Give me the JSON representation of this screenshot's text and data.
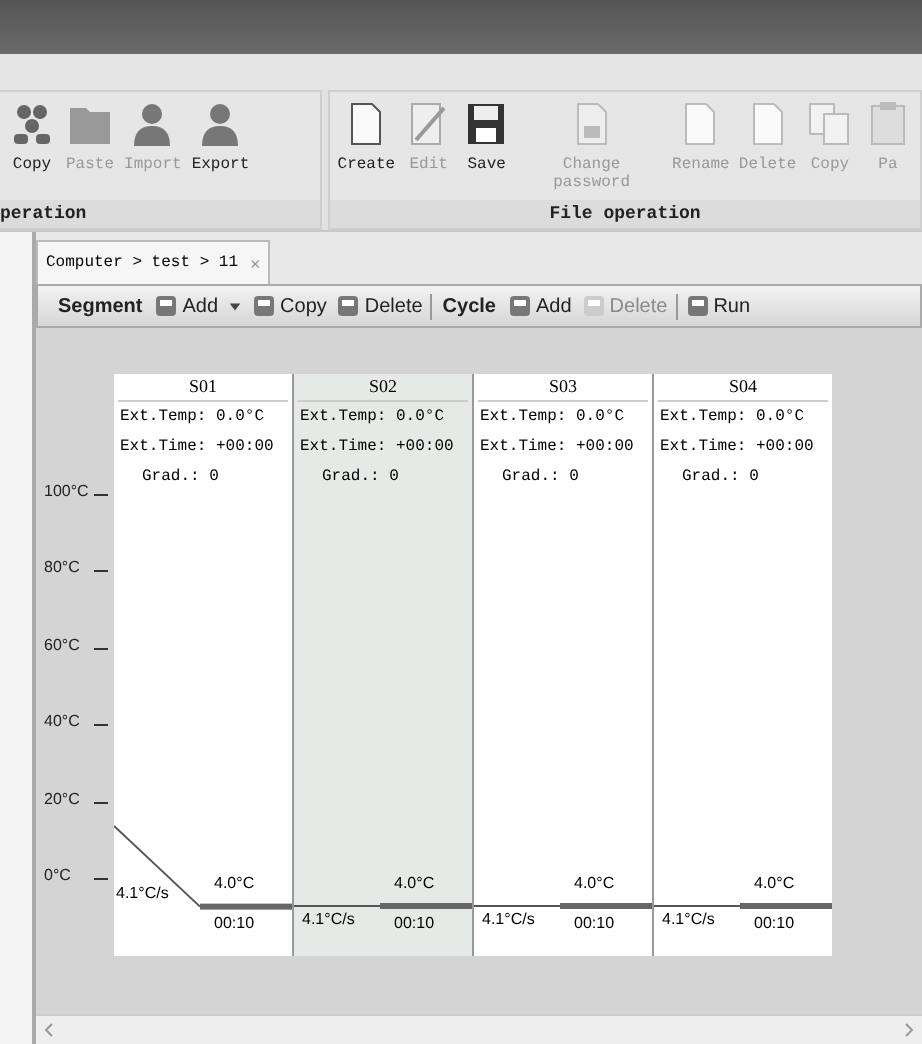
{
  "ribbon": {
    "groups": [
      {
        "label": "peration",
        "buttons": [
          {
            "label": "Copy",
            "kind": "people",
            "disabled": false
          },
          {
            "label": "Paste",
            "kind": "folder",
            "disabled": true
          },
          {
            "label": "Import",
            "kind": "person",
            "disabled": true
          },
          {
            "label": "Export",
            "kind": "person",
            "disabled": false
          }
        ]
      },
      {
        "label": "File operation",
        "buttons": [
          {
            "label": "Create",
            "kind": "page",
            "disabled": false
          },
          {
            "label": "Edit",
            "kind": "pencil",
            "disabled": true
          },
          {
            "label": "Save",
            "kind": "floppy",
            "disabled": false
          },
          {
            "label": "Change password",
            "kind": "lock",
            "disabled": true
          },
          {
            "label": "Rename",
            "kind": "page",
            "disabled": true
          },
          {
            "label": "Delete",
            "kind": "page",
            "disabled": true
          },
          {
            "label": "Copy",
            "kind": "pages",
            "disabled": true
          },
          {
            "label": "Pa",
            "kind": "clipboard",
            "disabled": true
          }
        ]
      }
    ]
  },
  "tab": {
    "label": "Computer > test > 11",
    "close": "×"
  },
  "toolbar": [
    {
      "kind": "heading",
      "label": "Segment"
    },
    {
      "kind": "button",
      "label": "Add",
      "disabled": false,
      "dropdown": true
    },
    {
      "kind": "button",
      "label": "Copy",
      "disabled": false,
      "dropdown": false
    },
    {
      "kind": "button",
      "label": "Delete",
      "disabled": false,
      "dropdown": false
    },
    {
      "kind": "separator"
    },
    {
      "kind": "heading",
      "label": "Cycle"
    },
    {
      "kind": "button",
      "label": "Add",
      "disabled": false,
      "dropdown": false
    },
    {
      "kind": "button",
      "label": "Delete",
      "disabled": true,
      "dropdown": false
    },
    {
      "kind": "separator"
    },
    {
      "kind": "button",
      "label": "Run",
      "disabled": false,
      "dropdown": false
    }
  ],
  "axis": [
    "100°C",
    "80°C",
    "60°C",
    "40°C",
    "20°C",
    "0°C"
  ],
  "segments": [
    {
      "label": "S01",
      "ext_temp": "Ext.Temp: 0.0°C",
      "ext_time": "Ext.Time: +00:00",
      "grad": "Grad.: 0",
      "rate": "4.1°C/s",
      "hold_temp": "4.0°C",
      "hold_time": "00:10",
      "selected": false
    },
    {
      "label": "S02",
      "ext_temp": "Ext.Temp: 0.0°C",
      "ext_time": "Ext.Time: +00:00",
      "grad": "Grad.: 0",
      "rate": "4.1°C/s",
      "hold_temp": "4.0°C",
      "hold_time": "00:10",
      "selected": true
    },
    {
      "label": "S03",
      "ext_temp": "Ext.Temp: 0.0°C",
      "ext_time": "Ext.Time: +00:00",
      "grad": "Grad.: 0",
      "rate": "4.1°C/s",
      "hold_temp": "4.0°C",
      "hold_time": "00:10",
      "selected": false
    },
    {
      "label": "S04",
      "ext_temp": "Ext.Temp: 0.0°C",
      "ext_time": "Ext.Time: +00:00",
      "grad": "Grad.: 0",
      "rate": "4.1°C/s",
      "hold_temp": "4.0°C",
      "hold_time": "00:10",
      "selected": false
    }
  ]
}
